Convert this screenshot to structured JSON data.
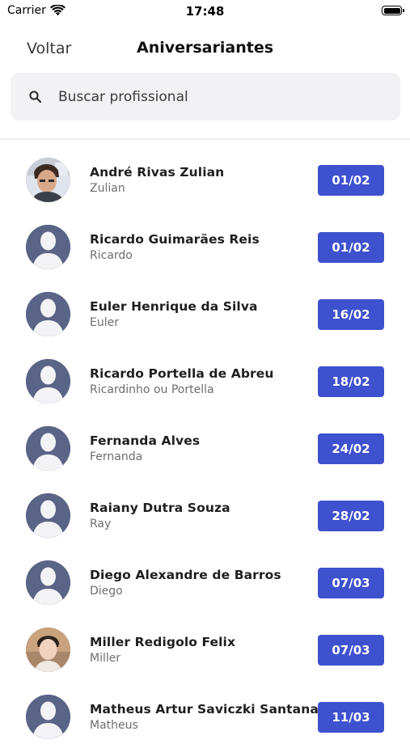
{
  "status_bar": {
    "carrier": "Carrier",
    "time": "17:48"
  },
  "nav": {
    "back_label": "Voltar",
    "title": "Aniversariantes"
  },
  "search": {
    "placeholder": "Buscar profissional"
  },
  "colors": {
    "accent": "#3e51cf",
    "avatar_bg": "#5a6486"
  },
  "people": [
    {
      "name": "André Rivas Zulian",
      "nickname": "Zulian",
      "date": "01/02",
      "avatar": "photo"
    },
    {
      "name": "Ricardo Guimarães Reis",
      "nickname": "Ricardo",
      "date": "01/02",
      "avatar": "default-person-icon"
    },
    {
      "name": "Euler Henrique da Silva",
      "nickname": "Euler",
      "date": "16/02",
      "avatar": "default-person-icon"
    },
    {
      "name": "Ricardo Portella de Abreu",
      "nickname": "Ricardinho ou Portella",
      "date": "18/02",
      "avatar": "default-person-icon"
    },
    {
      "name": "Fernanda Alves",
      "nickname": "Fernanda",
      "date": "24/02",
      "avatar": "default-person-icon"
    },
    {
      "name": "Raiany Dutra Souza",
      "nickname": "Ray",
      "date": "28/02",
      "avatar": "default-person-icon"
    },
    {
      "name": "Diego Alexandre de Barros",
      "nickname": "Diego",
      "date": "07/03",
      "avatar": "default-person-icon"
    },
    {
      "name": "Miller Redigolo Felix",
      "nickname": "Miller",
      "date": "07/03",
      "avatar": "photo"
    },
    {
      "name": "Matheus Artur Saviczki Santana",
      "nickname": "Matheus",
      "date": "11/03",
      "avatar": "default-person-icon"
    }
  ]
}
